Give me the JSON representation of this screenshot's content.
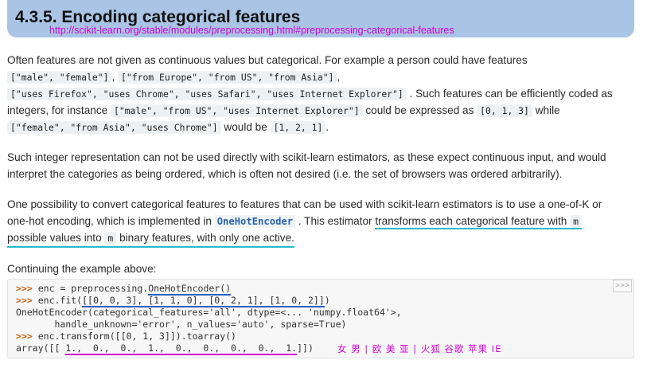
{
  "heading": {
    "title": "4.3.5. Encoding categorical features",
    "url": "http://scikit-learn.org/stable/modules/preprocessing.html#preprocessing-categorical-features"
  },
  "p1": {
    "l1": "Often features are not given as continuous values but categorical. For example a person could have features",
    "c1": "[\"male\", \"female\"]",
    "s1": ",",
    "c2": "[\"from Europe\", \"from US\", \"from Asia\"]",
    "s2": ",",
    "c3": "[\"uses Firefox\", \"uses Chrome\", \"uses Safari\", \"uses Internet Explorer\"]",
    "t3": ". Such features can be efficiently coded as",
    "t4a": "integers, for instance",
    "c4": "[\"male\", \"from US\", \"uses Internet Explorer\"]",
    "t4b": "could be expressed as",
    "c5": "[0, 1, 3]",
    "t4c": "while",
    "c6": "[\"female\", \"from Asia\", \"uses Chrome\"]",
    "t5": "would be",
    "c7": "[1, 2, 1]",
    "t5b": "."
  },
  "p2": {
    "l1": "Such integer representation can not be used directly with scikit-learn estimators, as these expect continuous input, and would",
    "l2": "interpret the categories as being ordered, which is often not desired (i.e. the set of browsers was ordered arbitrarily)."
  },
  "p3": {
    "l1": "One possibility to convert categorical features to features that can be used with scikit-learn estimators is to use a one-of-K or",
    "l2a": "one-hot encoding, which is implemented in",
    "ref": "OneHotEncoder",
    "l2b": ". This estimator",
    "l2c": "transforms each categorical feature with",
    "m1": "m",
    "l3a": "possible values into",
    "m2": "m",
    "l3b": "binary features, with only one active."
  },
  "p4": {
    "l1": "Continuing the example above:"
  },
  "code": {
    "prompt": ">>>",
    "line1_a": "enc = preprocessing.",
    "line1_b": "OneHotEncoder()",
    "line2_a": "enc.fit(",
    "line2_b": "[[0, 0, 3], [1, 1, 0], [0, 2, 1], [1, 0, 2]]",
    "line2_c": ")",
    "line3": "OneHotEncoder(categorical_features='all', dtype=<... 'numpy.float64'>,",
    "line4": "       handle_unknown='error', n_values='auto', sparse=True)",
    "line5": "enc.transform([[0, 1, 3]]).toarray()",
    "line6_a": "array([[ ",
    "line6_b": "1.,  0.,",
    "line6_c": "  0.,  1.,  0.,",
    "line6_d": "  0.,  0.,  0.,  1.",
    "line6_e": "]])",
    "copy_label": ">>>"
  },
  "annotation": "女 男 | 欧 美 亚 | 火狐 谷歌 苹果 IE",
  "colors": {
    "heading_bg": "#a9c4e4",
    "url": "#d100d1",
    "cyan_underline": "#29b8cf",
    "magenta": "#d100d1",
    "blue_underline": "#1f5fbf",
    "prompt": "#c65d09"
  }
}
